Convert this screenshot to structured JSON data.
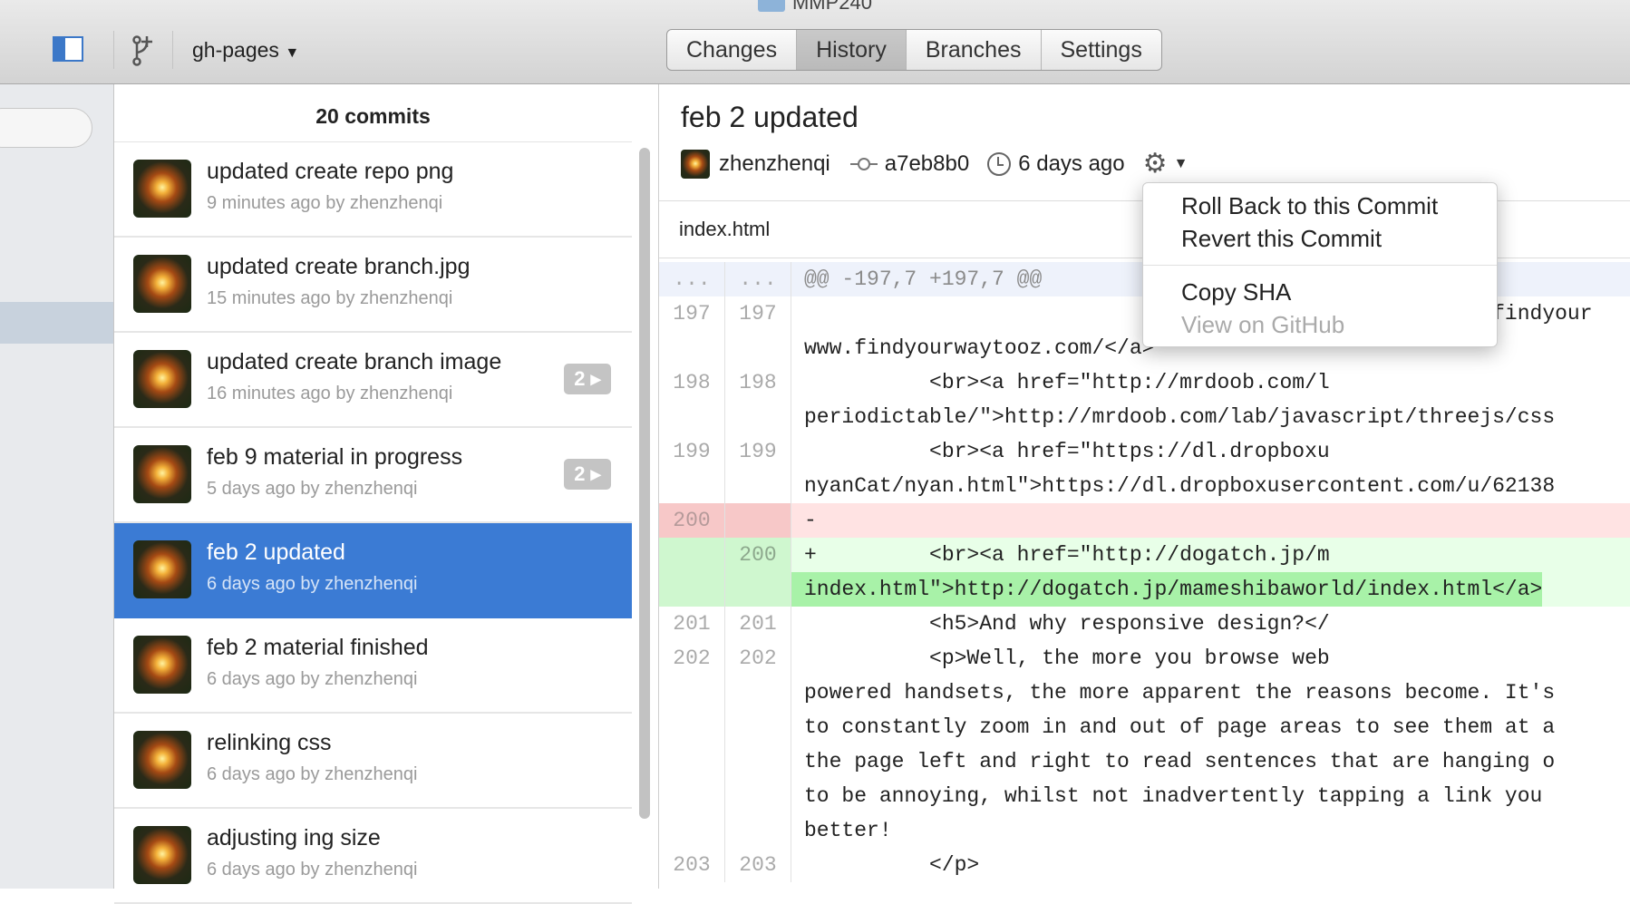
{
  "window": {
    "title": "MMP240"
  },
  "toolbar": {
    "branch": "gh-pages",
    "tabs": [
      {
        "label": "Changes"
      },
      {
        "label": "History"
      },
      {
        "label": "Branches"
      },
      {
        "label": "Settings"
      }
    ],
    "active_tab": "History"
  },
  "commits": {
    "count_label": "20 commits",
    "items": [
      {
        "message": "updated create repo png",
        "meta": "9 minutes ago by zhenzhenqi",
        "badge": ""
      },
      {
        "message": "updated create branch.jpg",
        "meta": "15 minutes ago by zhenzhenqi",
        "badge": ""
      },
      {
        "message": "updated create branch image",
        "meta": "16 minutes ago by zhenzhenqi",
        "badge": "2 ▸"
      },
      {
        "message": "feb 9 material in progress",
        "meta": "5 days ago by zhenzhenqi",
        "badge": "2 ▸"
      },
      {
        "message": "feb 2 updated",
        "meta": "6 days ago by zhenzhenqi",
        "badge": ""
      },
      {
        "message": "feb 2 material finished",
        "meta": "6 days ago by zhenzhenqi",
        "badge": ""
      },
      {
        "message": "relinking css",
        "meta": "6 days ago by zhenzhenqi",
        "badge": ""
      },
      {
        "message": "adjusting ing size",
        "meta": "6 days ago by zhenzhenqi",
        "badge": ""
      }
    ]
  },
  "detail": {
    "title": "feb 2 updated",
    "author": "zhenzhenqi",
    "sha": "a7eb8b0",
    "time": "6 days ago",
    "file": "index.html"
  },
  "diff": {
    "hunk": "@@ -197,7 +197,7 @@",
    "lines": [
      {
        "old": "197",
        "new": "197",
        "code": "                                                    ww.findyour"
      },
      {
        "old": "",
        "new": "",
        "code": "www.findyourwaytooz.com/</a>"
      },
      {
        "old": "198",
        "new": "198",
        "code": "          <br><a href=\"http://mrdoob.com/l"
      },
      {
        "old": "",
        "new": "",
        "code": "periodictable/\">http://mrdoob.com/lab/javascript/threejs/css"
      },
      {
        "old": "199",
        "new": "199",
        "code": "          <br><a href=\"https://dl.dropboxu"
      },
      {
        "old": "",
        "new": "",
        "code": "nyanCat/nyan.html\">https://dl.dropboxusercontent.com/u/62138"
      },
      {
        "old": "200",
        "new": "",
        "code": "-"
      },
      {
        "old": "",
        "new": "200",
        "code": "+         <br><a href=\"http://dogatch.jp/m"
      },
      {
        "old": "",
        "new": "",
        "code": "index.html\">http://dogatch.jp/mameshibaworld/index.html</a>"
      },
      {
        "old": "201",
        "new": "201",
        "code": "          <h5>And why responsive design?</"
      },
      {
        "old": "202",
        "new": "202",
        "code": "          <p>Well, the more you browse web"
      },
      {
        "old": "",
        "new": "",
        "code": "powered handsets, the more apparent the reasons become. It's"
      },
      {
        "old": "",
        "new": "",
        "code": "to constantly zoom in and out of page areas to see them at a"
      },
      {
        "old": "",
        "new": "",
        "code": "the page left and right to read sentences that are hanging o"
      },
      {
        "old": "",
        "new": "",
        "code": "to be annoying, whilst not inadvertently tapping a link you"
      },
      {
        "old": "",
        "new": "",
        "code": "better!"
      },
      {
        "old": "203",
        "new": "203",
        "code": "          </p>"
      }
    ]
  },
  "menu": {
    "items": [
      {
        "label": "Roll Back to this Commit",
        "enabled": true
      },
      {
        "label": "Revert this Commit",
        "enabled": true
      },
      {
        "label": "Copy SHA",
        "enabled": true
      },
      {
        "label": "View on GitHub",
        "enabled": false
      }
    ]
  }
}
